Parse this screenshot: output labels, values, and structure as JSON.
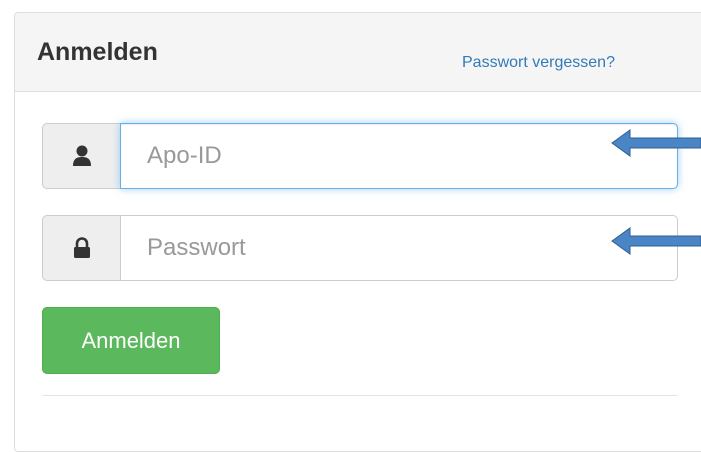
{
  "login": {
    "title": "Anmelden",
    "forgot_link": "Passwort vergessen?",
    "username": {
      "placeholder": "Apo-ID",
      "value": "",
      "icon": "user-icon"
    },
    "password": {
      "placeholder": "Passwort",
      "value": "",
      "icon": "lock-icon"
    },
    "submit_label": "Anmelden"
  },
  "colors": {
    "link": "#337ab7",
    "submit": "#5cb85c",
    "focus_border": "#66afe9",
    "annotation_arrow": "#4a86c5"
  }
}
